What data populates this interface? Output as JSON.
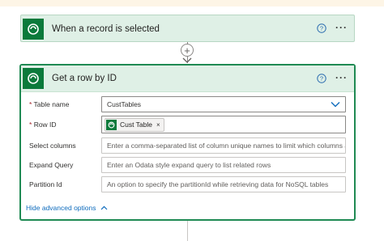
{
  "trigger": {
    "title": "When a record is selected",
    "help_icon": "question-circle-icon",
    "more_icon": "ellipsis-icon"
  },
  "connector": {
    "add_icon": "plus-icon",
    "arrow_icon": "arrow-down-icon"
  },
  "action": {
    "title": "Get a row by ID",
    "help_icon": "question-circle-icon",
    "more_icon": "ellipsis-icon",
    "fields": {
      "table_name": {
        "required": "*",
        "label": "Table name",
        "value": "CustTables"
      },
      "row_id": {
        "required": "*",
        "label": "Row ID",
        "token_label": "Cust Table",
        "token_close": "×"
      },
      "select_columns": {
        "label": "Select columns",
        "placeholder": "Enter a comma-separated list of column unique names to limit which columns a"
      },
      "expand_query": {
        "label": "Expand Query",
        "placeholder": "Enter an Odata style expand query to list related rows"
      },
      "partition_id": {
        "label": "Partition Id",
        "placeholder": "An option to specify the partitionId while retrieving data for NoSQL tables"
      }
    },
    "advanced_label": "Hide advanced options"
  },
  "colors": {
    "header_bg": "#dff0e6",
    "brand_green": "#0b7a3b",
    "link_blue": "#0f6cbd",
    "required_red": "#a4262c"
  }
}
